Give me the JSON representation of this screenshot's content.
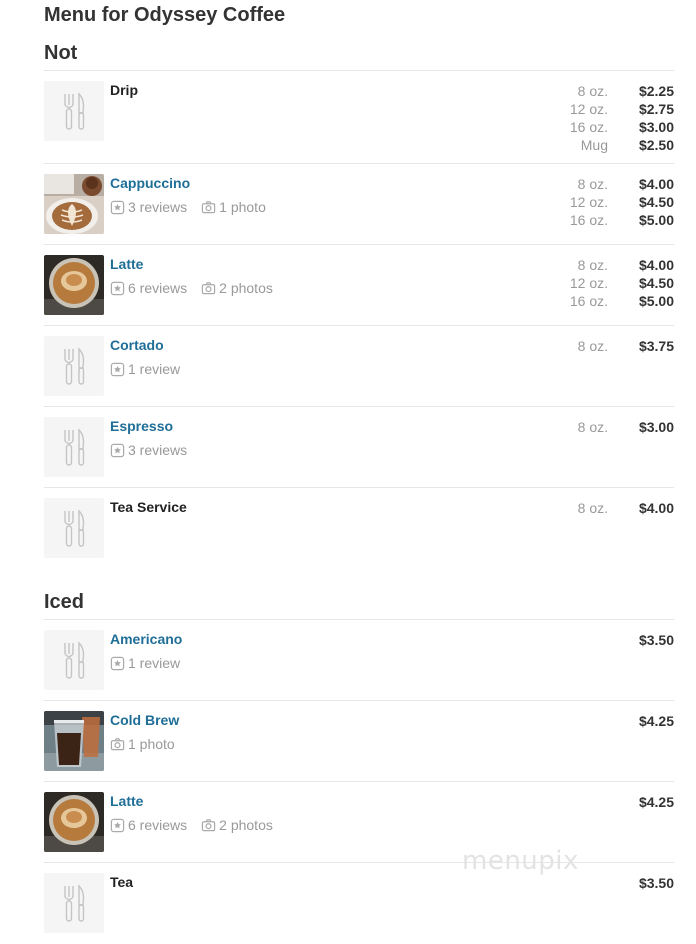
{
  "page_title": "Menu for Odyssey Coffee",
  "watermark": "menupix",
  "sections": [
    {
      "title": "Not",
      "items": [
        {
          "name": "Drip",
          "linked": false,
          "image": "placeholder",
          "reviews": "",
          "photos": "",
          "prices": [
            {
              "size": "8 oz.",
              "price": "$2.25"
            },
            {
              "size": "12 oz.",
              "price": "$2.75"
            },
            {
              "size": "16 oz.",
              "price": "$3.00"
            },
            {
              "size": "Mug",
              "price": "$2.50"
            }
          ]
        },
        {
          "name": "Cappuccino",
          "linked": true,
          "image": "cappuccino-photo",
          "reviews": "3 reviews",
          "photos": "1 photo",
          "prices": [
            {
              "size": "8 oz.",
              "price": "$4.00"
            },
            {
              "size": "12 oz.",
              "price": "$4.50"
            },
            {
              "size": "16 oz.",
              "price": "$5.00"
            }
          ]
        },
        {
          "name": "Latte",
          "linked": true,
          "image": "latte-photo",
          "reviews": "6 reviews",
          "photos": "2 photos",
          "prices": [
            {
              "size": "8 oz.",
              "price": "$4.00"
            },
            {
              "size": "12 oz.",
              "price": "$4.50"
            },
            {
              "size": "16 oz.",
              "price": "$5.00"
            }
          ]
        },
        {
          "name": "Cortado",
          "linked": true,
          "image": "placeholder",
          "reviews": "1 review",
          "photos": "",
          "prices": [
            {
              "size": "8 oz.",
              "price": "$3.75"
            }
          ]
        },
        {
          "name": "Espresso",
          "linked": true,
          "image": "placeholder",
          "reviews": "3 reviews",
          "photos": "",
          "prices": [
            {
              "size": "8 oz.",
              "price": "$3.00"
            }
          ]
        },
        {
          "name": "Tea Service",
          "linked": false,
          "image": "placeholder",
          "reviews": "",
          "photos": "",
          "prices": [
            {
              "size": "8 oz.",
              "price": "$4.00"
            }
          ]
        }
      ]
    },
    {
      "title": "Iced",
      "items": [
        {
          "name": "Americano",
          "linked": true,
          "image": "placeholder",
          "reviews": "1 review",
          "photos": "",
          "prices": [
            {
              "size": "",
              "price": "$3.50"
            }
          ]
        },
        {
          "name": "Cold Brew",
          "linked": true,
          "image": "cold-brew-photo",
          "reviews": "",
          "photos": "1 photo",
          "prices": [
            {
              "size": "",
              "price": "$4.25"
            }
          ]
        },
        {
          "name": "Latte",
          "linked": true,
          "image": "latte-photo",
          "reviews": "6 reviews",
          "photos": "2 photos",
          "prices": [
            {
              "size": "",
              "price": "$4.25"
            }
          ]
        },
        {
          "name": "Tea",
          "linked": false,
          "image": "placeholder",
          "reviews": "",
          "photos": "",
          "prices": [
            {
              "size": "",
              "price": "$3.50"
            }
          ]
        }
      ]
    }
  ],
  "colors": {
    "link": "#1f6e97",
    "muted": "#999999",
    "text": "#333333",
    "divider": "#e6e6e6",
    "placeholder_bg": "#f5f5f5"
  },
  "icons": {
    "placeholder": "utensils-icon",
    "reviews": "star-badge-icon",
    "photos": "camera-icon"
  }
}
